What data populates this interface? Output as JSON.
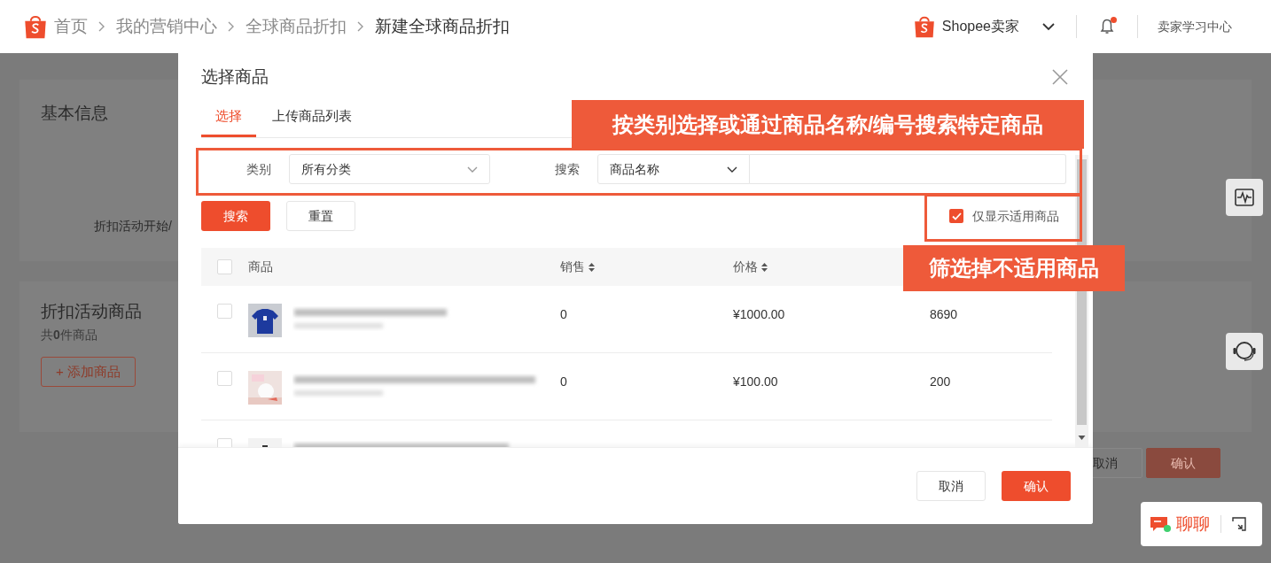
{
  "header": {
    "breadcrumbs": [
      {
        "label": "首页",
        "current": false
      },
      {
        "label": "我的营销中心",
        "current": false
      },
      {
        "label": "全球商品折扣",
        "current": false
      },
      {
        "label": "新建全球商品折扣",
        "current": true
      }
    ],
    "shop_name": "Shopee卖家",
    "has_notification": true,
    "learning_center": "卖家学习中心"
  },
  "page": {
    "basic_info": {
      "title": "基本信息",
      "field_label": "折扣活动开始/"
    },
    "products_section": {
      "title": "折扣活动商品",
      "count": "共**0**件商品",
      "add_button": "+ 添加商品"
    },
    "buttons": [
      {
        "label": "取消",
        "kind": "secondary"
      },
      {
        "label": "确认",
        "kind": "primary"
      }
    ]
  },
  "modal": {
    "title": "选择商品",
    "tabs": [
      {
        "label": "选择",
        "selected": true
      },
      {
        "label": "上传商品列表",
        "selected": false
      }
    ],
    "filters": {
      "category_label": "类别",
      "category_value": "所有分类",
      "search_label": "搜索",
      "search_type": "商品名称"
    },
    "search_button": "搜索",
    "reset_button": "重置",
    "only_applicable": {
      "label": "仅显示适用商品",
      "checked": true
    },
    "table": {
      "select_all_checked": false,
      "columns": [
        {
          "label": "商品",
          "sortable": false
        },
        {
          "label": "销售",
          "sortable": true
        },
        {
          "label": "价格",
          "sortable": true
        }
      ],
      "rows": [
        {
          "checked": false,
          "column_2": "0",
          "column_3": "¥1000.00",
          "column_4": "8690"
        },
        {
          "checked": false,
          "column_2": "0",
          "column_3": "¥100.00",
          "column_4": "200"
        },
        {
          "checked": false
        }
      ]
    },
    "footer_buttons": [
      {
        "label": "取消",
        "kind": "secondary"
      },
      {
        "label": "确认",
        "kind": "primary"
      }
    ]
  },
  "annotations": [
    {
      "text": "按类别选择或通过商品名称/编号搜索特定商品"
    },
    {
      "text": "筛选掉不适用商品"
    }
  ],
  "chat": {
    "label": "聊聊"
  }
}
